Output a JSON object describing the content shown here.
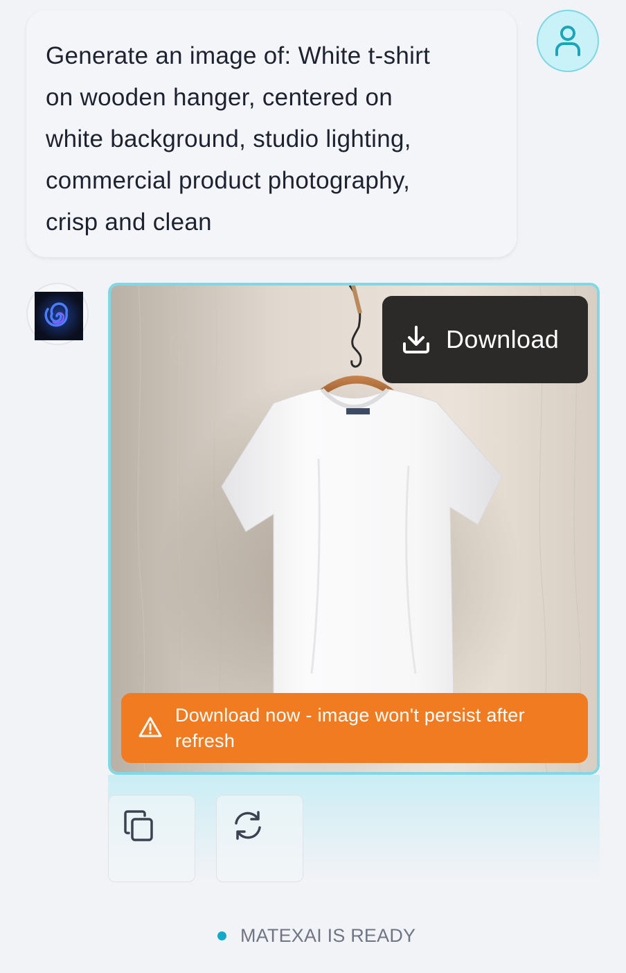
{
  "prompt": {
    "lines": [
      "Generate an image of: White t-shirt",
      "on wooden hanger, centered on",
      "white background, studio lighting,",
      "commercial product photography,",
      "crisp and clean"
    ]
  },
  "user_avatar": {
    "icon": "user-icon",
    "color": "#1aa5b8"
  },
  "bot_avatar": {
    "icon": "spiral-logo-icon"
  },
  "image_card": {
    "download_label": "Download",
    "warning_text": "Download now - image won't persist after refresh",
    "accent_border": "#7fd8e6",
    "warning_color": "#f07b21"
  },
  "actions": [
    {
      "icon": "copy-icon"
    },
    {
      "icon": "regenerate-icon"
    }
  ],
  "status": {
    "text": "MATEXAI IS READY",
    "dot_color": "#13a9c7"
  }
}
